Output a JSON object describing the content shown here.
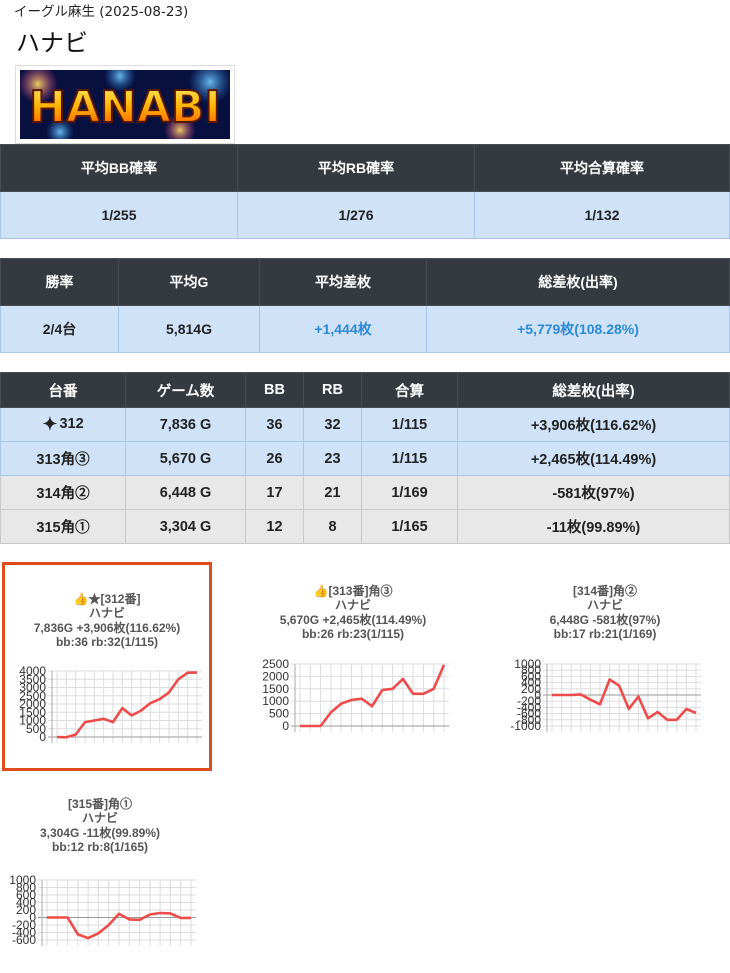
{
  "header": {
    "store": "イーグル麻生 (2025-08-23)",
    "title": "ハナビ",
    "logo_text": "HANABI"
  },
  "summary": {
    "headers": [
      "平均BB確率",
      "平均RB確率",
      "平均合算確率"
    ],
    "values": [
      "1/255",
      "1/276",
      "1/132"
    ]
  },
  "summary2": {
    "headers": [
      "勝率",
      "平均G",
      "平均差枚",
      "総差枚(出率)"
    ],
    "values": [
      "2/4台",
      "5,814G",
      "+1,444枚",
      "+5,779枚(108.28%)"
    ]
  },
  "machines": {
    "headers": [
      "台番",
      "ゲーム数",
      "BB",
      "RB",
      "合算",
      "総差枚(出率)"
    ],
    "rows": [
      {
        "no": "312",
        "games": "7,836 G",
        "bb": "36",
        "rb": "32",
        "total": "1/115",
        "diff": "+3,906枚(116.62%)",
        "status": "win",
        "icon": "sparkle-icon"
      },
      {
        "no": "313角③",
        "games": "5,670 G",
        "bb": "26",
        "rb": "23",
        "total": "1/115",
        "diff": "+2,465枚(114.49%)",
        "status": "win",
        "icon": ""
      },
      {
        "no": "314角②",
        "games": "6,448 G",
        "bb": "17",
        "rb": "21",
        "total": "1/169",
        "diff": "-581枚(97%)",
        "status": "lose",
        "icon": ""
      },
      {
        "no": "315角①",
        "games": "3,304 G",
        "bb": "12",
        "rb": "8",
        "total": "1/165",
        "diff": "-11枚(99.89%)",
        "status": "lose",
        "icon": ""
      }
    ]
  },
  "cards": [
    {
      "l1": "👍★[312番]",
      "l2": "ハナビ",
      "l3": "7,836G +3,906枚(116.62%)",
      "l4": "bb:36 rb:32(1/115)"
    },
    {
      "l1": "👍[313番]角③",
      "l2": "ハナビ",
      "l3": "5,670G +2,465枚(114.49%)",
      "l4": "bb:26 rb:23(1/115)"
    },
    {
      "l1": "[314番]角②",
      "l2": "ハナビ",
      "l3": "6,448G -581枚(97%)",
      "l4": "bb:17 rb:21(1/169)"
    },
    {
      "l1": "[315番]角①",
      "l2": "ハナビ",
      "l3": "3,304G -11枚(99.89%)",
      "l4": "bb:12 rb:8(1/165)"
    }
  ],
  "chart_data": [
    {
      "type": "line",
      "series": [
        {
          "values": [
            0,
            -20,
            150,
            900,
            1000,
            1100,
            900,
            1750,
            1300,
            1600,
            2050,
            2300,
            2700,
            3500,
            3900,
            3906
          ]
        }
      ],
      "y_ticks": [
        4000,
        3500,
        3000,
        2500,
        2000,
        1500,
        1000,
        500,
        0
      ],
      "ylim": [
        0,
        4000
      ],
      "color": "#ef4b4b",
      "grid": true
    },
    {
      "type": "line",
      "series": [
        {
          "values": [
            0,
            0,
            0,
            550,
            900,
            1050,
            1100,
            800,
            1450,
            1500,
            1900,
            1300,
            1300,
            1500,
            2465
          ]
        }
      ],
      "y_ticks": [
        2500,
        2000,
        1500,
        1000,
        500,
        0
      ],
      "ylim": [
        0,
        2500
      ],
      "color": "#ef4b4b",
      "grid": true
    },
    {
      "type": "line",
      "series": [
        {
          "values": [
            0,
            0,
            0,
            20,
            -150,
            -300,
            500,
            300,
            -450,
            -50,
            -750,
            -550,
            -800,
            -800,
            -450,
            -581
          ]
        }
      ],
      "y_ticks": [
        1000,
        800,
        600,
        400,
        200,
        0,
        -200,
        -400,
        -600,
        -800,
        -1000
      ],
      "ylim": [
        -1000,
        1000
      ],
      "color": "#ef4b4b",
      "grid": true
    },
    {
      "type": "line",
      "series": [
        {
          "values": [
            0,
            0,
            0,
            -450,
            -550,
            -420,
            -200,
            100,
            -50,
            -60,
            80,
            120,
            110,
            -10,
            -11
          ]
        }
      ],
      "y_ticks": [
        1000,
        800,
        600,
        400,
        200,
        0,
        -200,
        -400,
        -600
      ],
      "ylim": [
        -600,
        1000
      ],
      "color": "#ef4b4b",
      "grid": true
    }
  ]
}
